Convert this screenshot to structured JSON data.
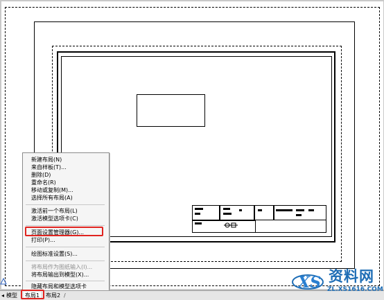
{
  "menu": {
    "items": [
      {
        "label": "新建布局(N)",
        "disabled": false
      },
      {
        "label": "来自样板(T)...",
        "disabled": false
      },
      {
        "label": "删除(D)",
        "disabled": false
      },
      {
        "label": "重命名(R)",
        "disabled": false
      },
      {
        "label": "移动或复制(M)...",
        "disabled": false
      },
      {
        "label": "选择所有布局(A)",
        "disabled": false
      },
      {
        "label": "激活前一个布局(L)",
        "disabled": false
      },
      {
        "label": "激活模型选项卡(C)",
        "disabled": false
      },
      {
        "label": "页面设置管理器(G)...",
        "disabled": false,
        "highlighted": true
      },
      {
        "label": "打印(P)...",
        "disabled": false
      },
      {
        "label": "绘图标准设置(S)...",
        "disabled": false
      },
      {
        "label": "将布局作为图纸输入(I)...",
        "disabled": true
      },
      {
        "label": "将布局输出到模型(X)...",
        "disabled": false
      },
      {
        "label": "隐藏布局和模型选项卡",
        "disabled": false
      }
    ]
  },
  "tabs": {
    "model": "模型",
    "layout1": "布局1",
    "layout2": "布局2"
  },
  "watermark": {
    "title": "资料网",
    "url": "ZL.XS1616.COM"
  },
  "colors": {
    "highlight": "#e0231f",
    "watermark": "#1e6db5"
  }
}
